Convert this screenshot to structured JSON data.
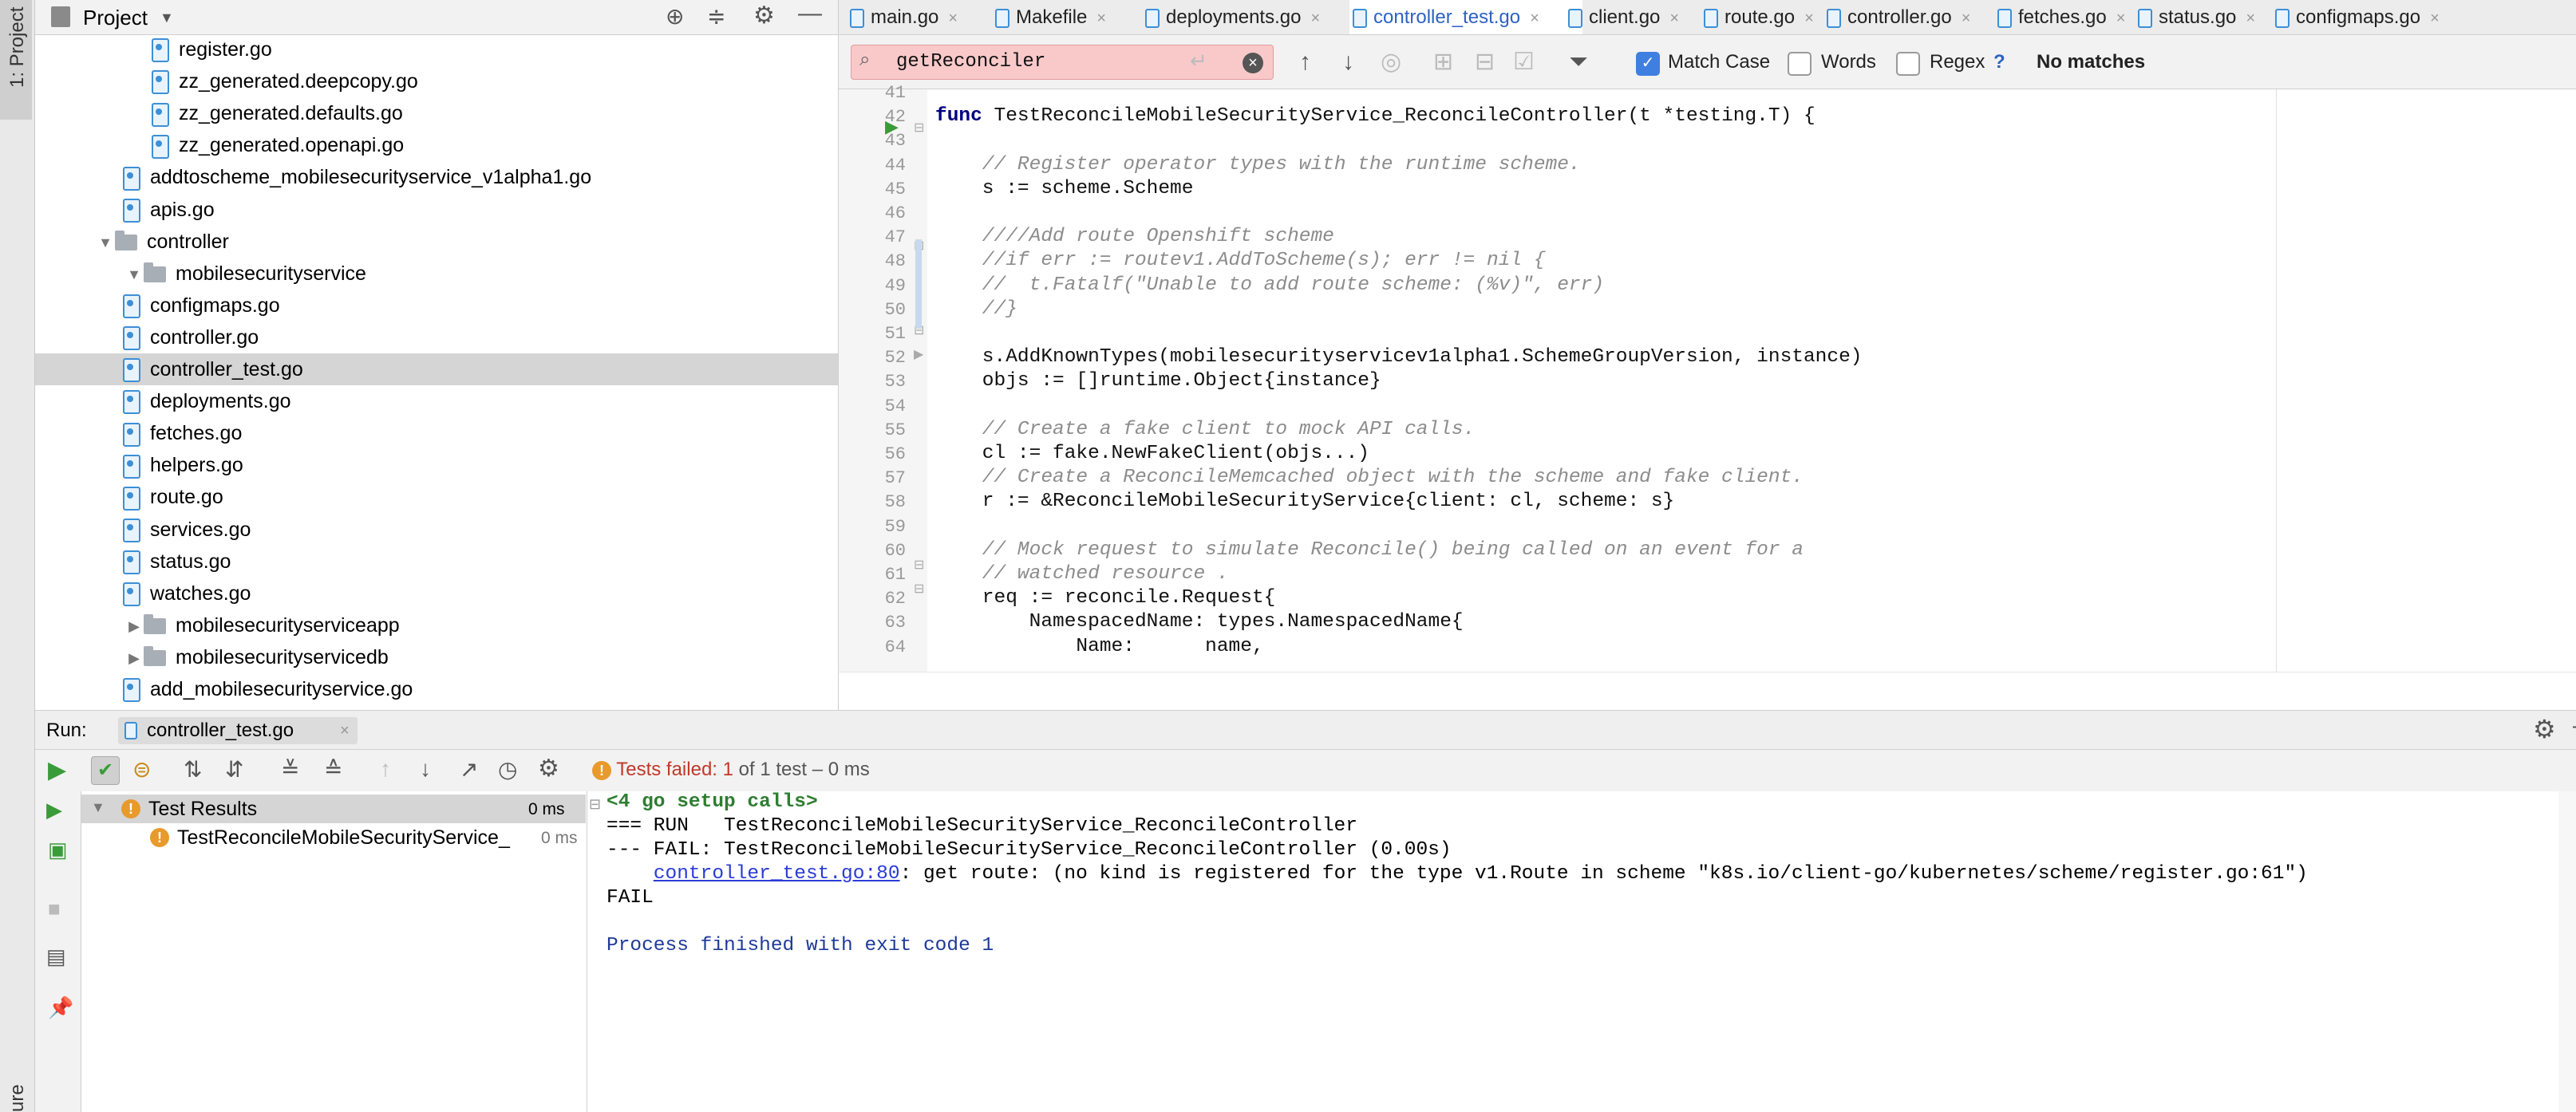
{
  "left_strip": {
    "project_label": "1: Project",
    "structure_label": "ure"
  },
  "project_panel": {
    "title": "Project",
    "tree": [
      {
        "label": "register.go",
        "type": "file"
      },
      {
        "label": "zz_generated.deepcopy.go",
        "type": "file"
      },
      {
        "label": "zz_generated.defaults.go",
        "type": "file"
      },
      {
        "label": "zz_generated.openapi.go",
        "type": "file"
      },
      {
        "label": "addtoscheme_mobilesecurityservice_v1alpha1.go",
        "type": "file"
      },
      {
        "label": "apis.go",
        "type": "file"
      },
      {
        "label": "controller",
        "type": "folder-open"
      },
      {
        "label": "mobilesecurityservice",
        "type": "folder-open"
      },
      {
        "label": "configmaps.go",
        "type": "file"
      },
      {
        "label": "controller.go",
        "type": "file"
      },
      {
        "label": "controller_test.go",
        "type": "file",
        "selected": true
      },
      {
        "label": "deployments.go",
        "type": "file"
      },
      {
        "label": "fetches.go",
        "type": "file"
      },
      {
        "label": "helpers.go",
        "type": "file"
      },
      {
        "label": "route.go",
        "type": "file"
      },
      {
        "label": "services.go",
        "type": "file"
      },
      {
        "label": "status.go",
        "type": "file"
      },
      {
        "label": "watches.go",
        "type": "file"
      },
      {
        "label": "mobilesecurityserviceapp",
        "type": "folder-closed"
      },
      {
        "label": "mobilesecurityservicedb",
        "type": "folder-closed"
      },
      {
        "label": "add_mobilesecurityservice.go",
        "type": "file"
      }
    ]
  },
  "tabs": [
    {
      "label": "main.go"
    },
    {
      "label": "Makefile"
    },
    {
      "label": "deployments.go"
    },
    {
      "label": "controller_test.go",
      "active": true
    },
    {
      "label": "client.go"
    },
    {
      "label": "route.go"
    },
    {
      "label": "controller.go"
    },
    {
      "label": "fetches.go"
    },
    {
      "label": "status.go"
    },
    {
      "label": "configmaps.go"
    }
  ],
  "search": {
    "query": "getReconciler",
    "match_case_label": "Match Case",
    "match_case_checked": true,
    "words_label": "Words",
    "regex_label": "Regex",
    "help": "?",
    "result": "No matches"
  },
  "editor": {
    "lines": [
      {
        "n": "41",
        "text": "",
        "kind": "code"
      },
      {
        "n": "42",
        "text": "func TestReconcileMobileSecurityService_ReconcileController(t *testing.T) {",
        "kind": "func"
      },
      {
        "n": "43",
        "text": "",
        "kind": "code"
      },
      {
        "n": "44",
        "text": "    // Register operator types with the runtime scheme.",
        "kind": "comment"
      },
      {
        "n": "45",
        "text": "    s := scheme.Scheme",
        "kind": "code"
      },
      {
        "n": "46",
        "text": "",
        "kind": "code"
      },
      {
        "n": "47",
        "text": "    ////Add route Openshift scheme",
        "kind": "comment"
      },
      {
        "n": "48",
        "text": "    //if err := routev1.AddToScheme(s); err != nil {",
        "kind": "comment"
      },
      {
        "n": "49",
        "text": "    //  t.Fatalf(\"Unable to add route scheme: (%v)\", err)",
        "kind": "comment"
      },
      {
        "n": "50",
        "text": "    //}",
        "kind": "comment"
      },
      {
        "n": "51",
        "text": "",
        "kind": "code"
      },
      {
        "n": "52",
        "text": "    s.AddKnownTypes(mobilesecurityservicev1alpha1.SchemeGroupVersion, instance)",
        "kind": "code"
      },
      {
        "n": "53",
        "text": "    objs := []runtime.Object{instance}",
        "kind": "code"
      },
      {
        "n": "54",
        "text": "",
        "kind": "code"
      },
      {
        "n": "55",
        "text": "    // Create a fake client to mock API calls.",
        "kind": "comment"
      },
      {
        "n": "56",
        "text": "    cl := fake.NewFakeClient(objs...)",
        "kind": "code"
      },
      {
        "n": "57",
        "text": "    // Create a ReconcileMemcached object with the scheme and fake client.",
        "kind": "comment"
      },
      {
        "n": "58",
        "text": "    r := &ReconcileMobileSecurityService{client: cl, scheme: s}",
        "kind": "code"
      },
      {
        "n": "59",
        "text": "",
        "kind": "code"
      },
      {
        "n": "60",
        "text": "    // Mock request to simulate Reconcile() being called on an event for a",
        "kind": "comment"
      },
      {
        "n": "61",
        "text": "    // watched resource .",
        "kind": "comment"
      },
      {
        "n": "62",
        "text": "    req := reconcile.Request{",
        "kind": "code"
      },
      {
        "n": "63",
        "text": "        NamespacedName: types.NamespacedName{",
        "kind": "code"
      },
      {
        "n": "64",
        "text": "            Name:      name,",
        "kind": "code"
      }
    ]
  },
  "run": {
    "label": "Run:",
    "tab": "controller_test.go",
    "status_prefix": "Tests failed:",
    "status_count": "1",
    "status_suffix": "of 1 test – 0 ms",
    "results": [
      {
        "label": "Test Results",
        "time": "0 ms"
      },
      {
        "label": "TestReconcileMobileSecurityService_",
        "time": "0 ms"
      }
    ],
    "console": {
      "setup": "<4 go setup calls>",
      "run_line": "=== RUN   TestReconcileMobileSecurityService_ReconcileController",
      "fail_line": "--- FAIL: TestReconcileMobileSecurityService_ReconcileController (0.00s)",
      "link": "controller_test.go:80",
      "error": ": get route: (no kind is registered for the type v1.Route in scheme \"k8s.io/client-go/kubernetes/scheme/register.go:61\")",
      "fail": "FAIL",
      "exit": "Process finished with exit code 1"
    }
  },
  "colors": {
    "accent": "#4a86e8",
    "search_no_match_bg": "#f9c9c9",
    "comment": "#8c8c8c",
    "link": "#2a3bd6",
    "warning": "#e89a2c",
    "success": "#3a9b3a"
  }
}
